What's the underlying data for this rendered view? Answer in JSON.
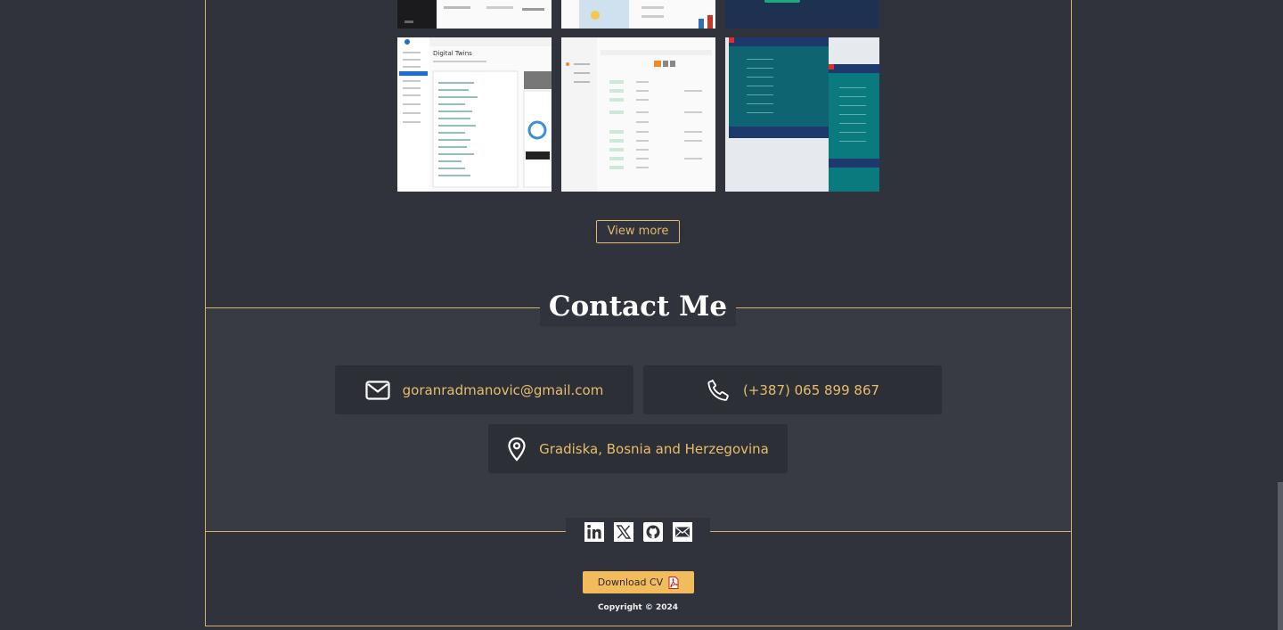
{
  "portfolio": {
    "view_more_label": "View more",
    "thumbnails": [
      {
        "name": "project-thumbnail-dark-dashboard",
        "theme": "dark"
      },
      {
        "name": "project-thumbnail-map-report",
        "theme": "light"
      },
      {
        "name": "project-thumbnail-dark-app",
        "theme": "dark"
      },
      {
        "name": "project-thumbnail-digital-twins",
        "theme": "light",
        "heading": "Digital Twins"
      },
      {
        "name": "project-thumbnail-table-app",
        "theme": "light"
      },
      {
        "name": "project-thumbnail-trading-grid",
        "theme": "dark"
      }
    ]
  },
  "contact": {
    "title": "Contact Me",
    "email": "goranradmanovic@gmail.com",
    "phone": "(+387) 065 899 867",
    "location": "Gradiska, Bosnia and Herzegovina"
  },
  "social": {
    "icons": [
      "linkedin-icon",
      "x-twitter-icon",
      "github-icon",
      "mail-icon"
    ]
  },
  "footer": {
    "download_label": "Download CV",
    "copyright": "Copyright © 2024"
  },
  "colors": {
    "background": "#30333b",
    "accent": "#e2b96a",
    "button": "#f2bb5b",
    "card": "#2c2f35"
  }
}
